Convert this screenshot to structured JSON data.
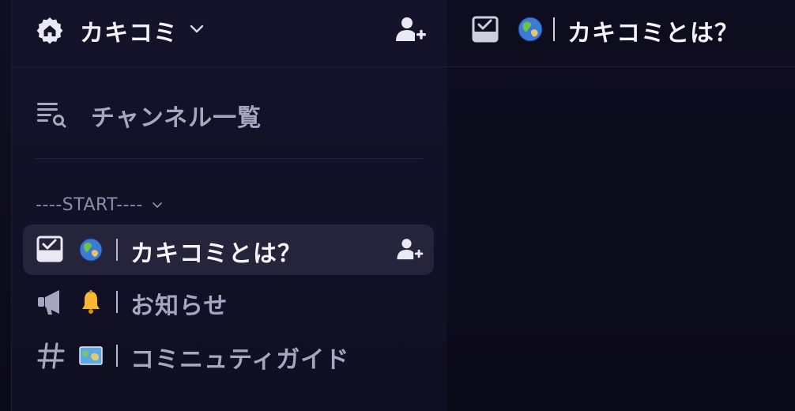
{
  "server": {
    "name": "カキコミ",
    "icon": "home-icon",
    "chevron_icon": "chevron-down-icon",
    "invite_icon": "add-member-icon"
  },
  "main_header": {
    "channel_icon": "forum-check-icon",
    "emoji": "globe-emoji",
    "title": "カキコミとは？"
  },
  "channel_list_link": {
    "icon": "list-search-icon",
    "label": "チャンネル一覧"
  },
  "category": {
    "label": "----START----",
    "chevron_icon": "chevron-down-icon"
  },
  "channels": [
    {
      "icon": "forum-check-icon",
      "emoji": "globe-emoji",
      "name": "カキコミとは？",
      "active": true,
      "invite_icon": "add-member-icon"
    },
    {
      "icon": "megaphone-icon",
      "emoji": "bell-emoji",
      "name": "お知らせ",
      "active": false
    },
    {
      "icon": "hashtag-icon",
      "emoji": "map-emoji",
      "name": "コミニュティガイド",
      "active": false
    }
  ],
  "colors": {
    "background": "#0c0b1a",
    "sidebar": "#14132a",
    "active_row": "#25243a",
    "text_primary": "#f5f4fc",
    "text_muted": "#a8a6bf"
  }
}
